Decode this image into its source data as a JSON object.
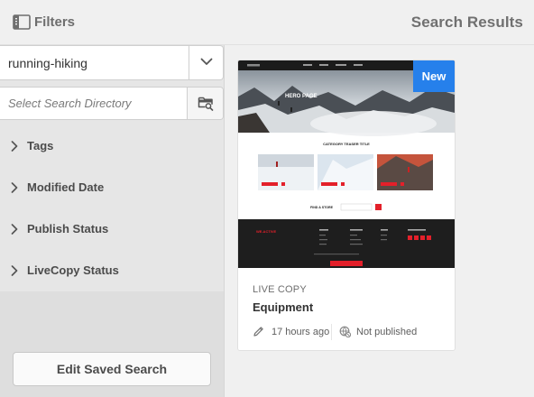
{
  "header": {
    "filters_label": "Filters",
    "results_label": "Search Results"
  },
  "sidebar": {
    "selected_search": "running-hiking",
    "directory_placeholder": "Select Search Directory",
    "facets": [
      {
        "label": "Tags"
      },
      {
        "label": "Modified Date"
      },
      {
        "label": "Publish Status"
      },
      {
        "label": "LiveCopy Status"
      }
    ],
    "edit_saved_search_label": "Edit Saved Search"
  },
  "results": [
    {
      "badge": "New",
      "type": "LIVE COPY",
      "title": "Equipment",
      "modified": "17 hours ago",
      "status": "Not published",
      "thumbnail": {
        "hero_title": "HERO PAGE",
        "teaser_title": "CATEGORY TEASER TITLE",
        "find_store_label": "FIND A STORE",
        "footer_logo": "WE.ACTIVE"
      }
    }
  ],
  "colors": {
    "accent": "#2680eb",
    "red": "#e3202a"
  }
}
